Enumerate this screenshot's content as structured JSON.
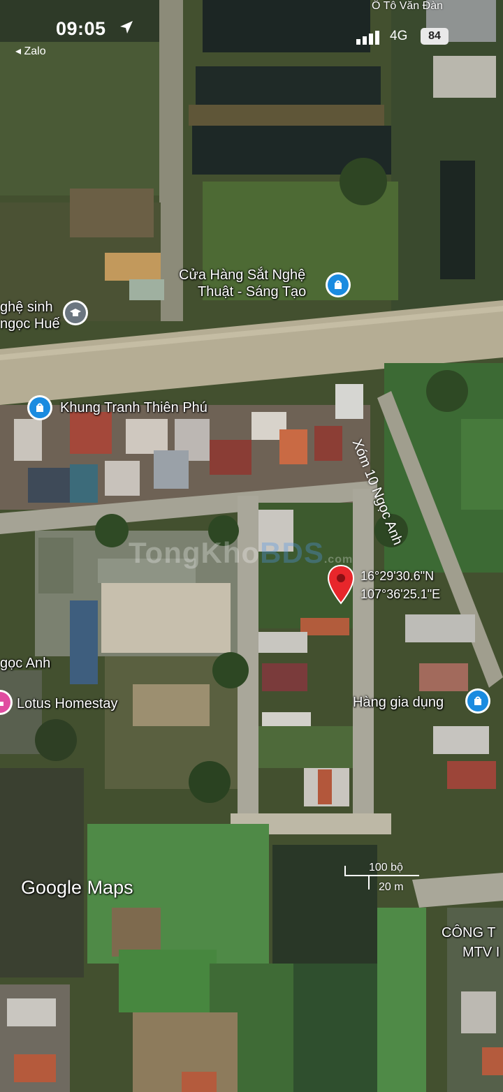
{
  "status_bar": {
    "time": "09:05",
    "back_app": "◂ Zalo",
    "network": "4G",
    "battery": "84",
    "top_edge_text": "Ô Tô Văn Đàn"
  },
  "map": {
    "pois": [
      {
        "id": "cua-hang-sat",
        "line1": "Cửa Hàng Sắt Nghệ",
        "line2": "Thuật - Sáng Tạo",
        "icon": "shopping-bag-icon"
      },
      {
        "id": "nghe-sinh",
        "line1": "ghệ sinh",
        "line2": "ngọc Huế",
        "icon": "school-cap-icon"
      },
      {
        "id": "khung-tranh",
        "line1": "Khung Tranh Thiên Phú",
        "icon": "shopping-bag-icon"
      },
      {
        "id": "ngoc-anh",
        "line1": "gọc Anh"
      },
      {
        "id": "lotus",
        "line1": "Lotus Homestay",
        "icon": "lodging-icon"
      },
      {
        "id": "hang-gia-dung",
        "line1": "Hàng gia dụng",
        "icon": "shopping-bag-icon"
      },
      {
        "id": "cong-ty",
        "line1": "CÔNG T",
        "line2": "MTV I"
      }
    ],
    "road_label": "Xóm 10 Ngọc Anh",
    "pin": {
      "lat": "16°29'30.6\"N",
      "lng": "107°36'25.1\"E",
      "color": "#e8262b"
    },
    "watermark": {
      "part1": "TongKho",
      "part2": "BDS",
      "suffix": ".com"
    },
    "branding": "Google Maps",
    "scale": {
      "top": "100 bộ",
      "bottom": "20 m"
    }
  }
}
